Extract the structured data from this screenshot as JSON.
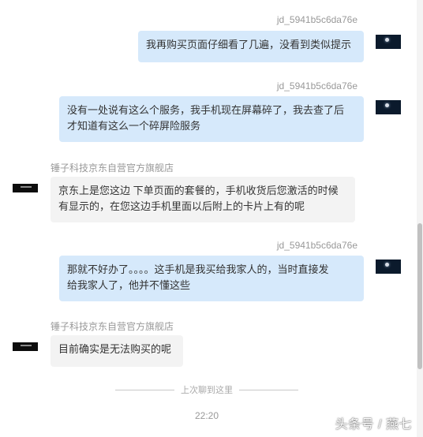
{
  "messages": [
    {
      "direction": "out",
      "sender": "jd_5941b5c6da76e",
      "text": "我再购买页面仔细看了几遍，没看到类似提示"
    },
    {
      "direction": "out",
      "sender": "jd_5941b5c6da76e",
      "text": "没有一处说有这么个服务，我手机现在屏幕碎了，我去查了后\n才知道有这么一个碎屏险服务"
    },
    {
      "direction": "in",
      "sender": "锤子科技京东自营官方旗舰店",
      "text": "京东上是您这边 下单页面的套餐的，手机收货后您激活的时候\n有显示的，在您这边手机里面以后附上的卡片上有的呢"
    },
    {
      "direction": "out",
      "sender": "jd_5941b5c6da76e",
      "text": "那就不好办了。。。。这手机是我买给我家人的，当时直接发\n给我家人了，他并不懂这些"
    },
    {
      "direction": "in",
      "sender": "锤子科技京东自营官方旗舰店",
      "text": "目前确实是无法购买的呢"
    }
  ],
  "divider_text": "上次聊到这里",
  "time": "22:20",
  "watermark": "头条号 / 燕七",
  "colors": {
    "outgoing_bubble": "#d6e9fb",
    "incoming_bubble": "#f3f3f3",
    "meta_text": "#999999"
  },
  "icons": {
    "outgoing_avatar": "night-sky-avatar-icon",
    "incoming_avatar": "smartisan-logo-avatar-icon"
  }
}
